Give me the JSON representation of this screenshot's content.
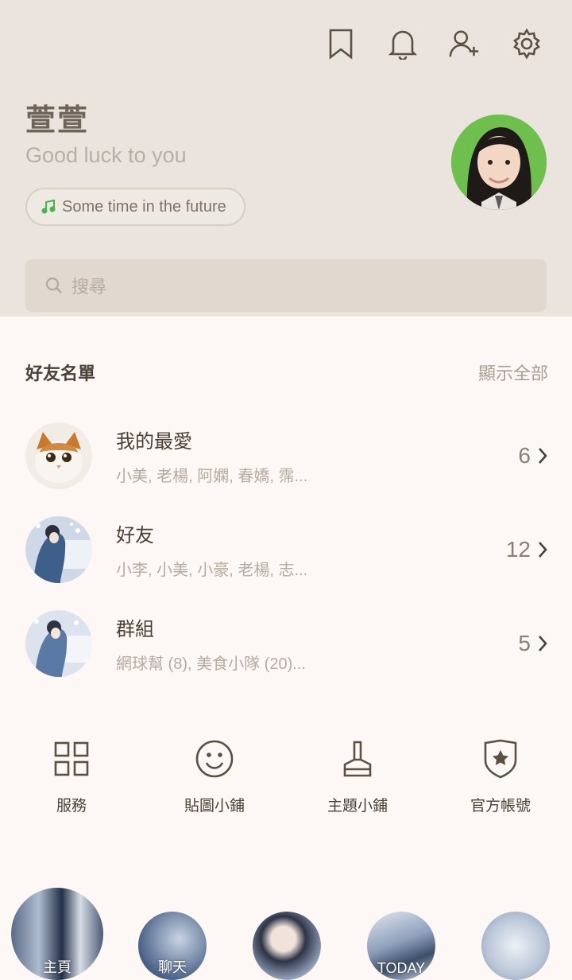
{
  "header": {
    "icons": [
      "bookmark-icon",
      "bell-icon",
      "add-friend-icon",
      "settings-icon"
    ],
    "profile_name": "萱萱",
    "status_message": "Good luck to you",
    "music_label": "Some time in the future"
  },
  "search": {
    "placeholder": "搜尋"
  },
  "friends": {
    "title": "好友名單",
    "show_all": "顯示全部",
    "rows": [
      {
        "title": "我的最愛",
        "subtitle": "小美, 老楊, 阿嫻, 春嬌, 霈...",
        "count": "6"
      },
      {
        "title": "好友",
        "subtitle": "小李, 小美, 小豪, 老楊, 志...",
        "count": "12"
      },
      {
        "title": "群組",
        "subtitle": "網球幫 (8), 美食小隊 (20)...",
        "count": "5"
      }
    ]
  },
  "shortcuts": [
    {
      "label": "服務",
      "icon": "grid-icon"
    },
    {
      "label": "貼圖小鋪",
      "icon": "smiley-icon"
    },
    {
      "label": "主題小鋪",
      "icon": "brush-icon"
    },
    {
      "label": "官方帳號",
      "icon": "shield-star-icon"
    }
  ],
  "bottom_nav": [
    {
      "label": "主頁"
    },
    {
      "label": "聊天"
    },
    {
      "label": ""
    },
    {
      "label": "TODAY"
    },
    {
      "label": ""
    }
  ],
  "colors": {
    "header_bg": "#ebe4de",
    "body_bg": "#fdf8f5",
    "accent_green": "#4ab34a"
  }
}
